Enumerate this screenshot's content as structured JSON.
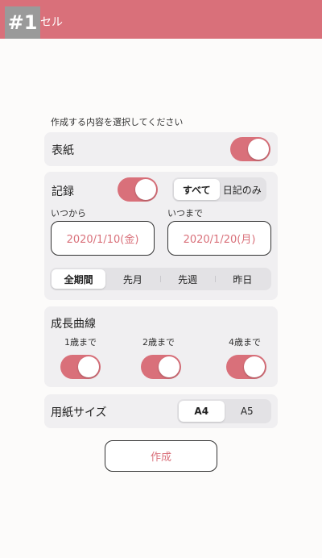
{
  "header": {
    "badge": "#1",
    "title_partial": "セル"
  },
  "instruction": "作成する内容を選択してください",
  "cover": {
    "label": "表紙",
    "enabled": true
  },
  "record": {
    "label": "記録",
    "enabled": true,
    "filter": {
      "options": [
        "すべて",
        "日記のみ"
      ],
      "selected": "すべて"
    },
    "from_label": "いつから",
    "to_label": "いつまで",
    "from_date": "2020/1/10(金)",
    "to_date": "2020/1/20(月)",
    "period": {
      "options": [
        "全期間",
        "先月",
        "先週",
        "昨日"
      ],
      "selected": "全期間"
    }
  },
  "growth": {
    "label": "成長曲線",
    "items": [
      {
        "label": "1歳まで",
        "enabled": true
      },
      {
        "label": "2歳まで",
        "enabled": true
      },
      {
        "label": "4歳まで",
        "enabled": true
      }
    ]
  },
  "paper": {
    "label": "用紙サイズ",
    "options": [
      "A4",
      "A5"
    ],
    "selected": "A4"
  },
  "create_label": "作成",
  "colors": {
    "accent": "#d9707a",
    "card": "#f0eff1",
    "background": "#fcfbfa"
  }
}
